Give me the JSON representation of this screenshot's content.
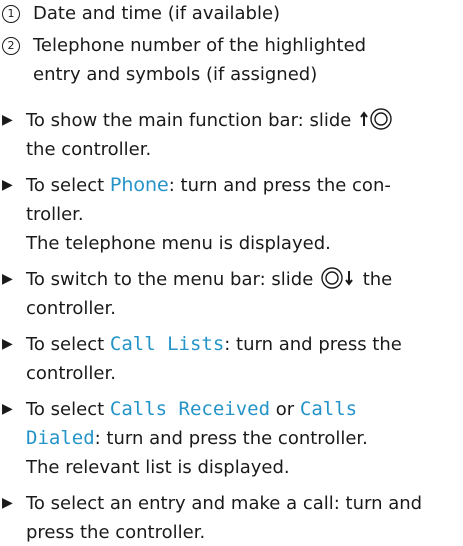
{
  "legend": [
    {
      "number": "1",
      "lines": [
        "Date and time (if available)"
      ]
    },
    {
      "number": "2",
      "lines": [
        "Telephone number of the highlighted",
        "entry and symbols (if assigned)"
      ]
    }
  ],
  "steps": {
    "s1": {
      "a": "To show the main function bar: slide ",
      "b": "the controller."
    },
    "s2": {
      "a": "To select ",
      "ui": "Phone",
      "b": ": turn and press the con-",
      "c": "troller.",
      "result": "The telephone menu is displayed."
    },
    "s3": {
      "a": "To switch to the menu bar: slide ",
      "b": " the",
      "c": "controller."
    },
    "s4": {
      "a": "To select ",
      "ui": "Call Lists",
      "b": ": turn and press the",
      "c": "controller."
    },
    "s5": {
      "a": "To select ",
      "ui1": "Calls Received",
      "or": " or ",
      "ui2": "Calls",
      "ui3": "Dialed",
      "b": ": turn and press the controller.",
      "result": "The relevant list is displayed."
    },
    "s6": {
      "a": "To select an entry and make a call: turn and",
      "b": "press the controller."
    }
  },
  "icons": {
    "bullet": "triangle-bullet-icon",
    "controller_up": "slide-up-controller-icon",
    "controller_down": "slide-down-controller-icon"
  },
  "colors": {
    "ui_text": "#2494c8",
    "body_text": "#1a1a1a"
  }
}
